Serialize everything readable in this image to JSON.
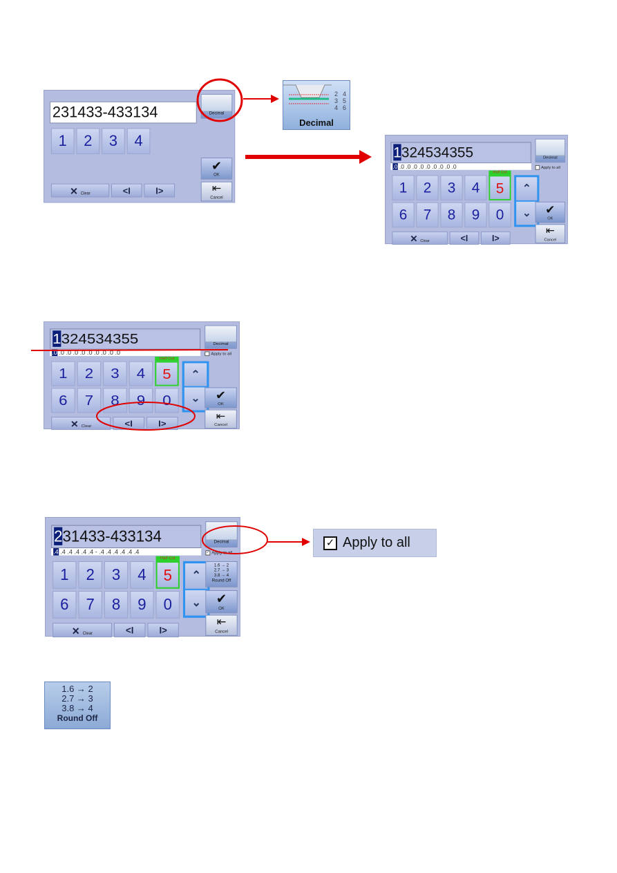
{
  "labels": {
    "clear": "Clear",
    "ok": "OK",
    "cancel": "Cancel",
    "decimal": "Decimal",
    "apply_to_all": "Apply to all",
    "half_cut": "Half Cut",
    "prev": "<I",
    "next": "I>",
    "clear_icon": "✕",
    "ok_icon": "✔",
    "cancel_icon": "⇤",
    "up": "⌃",
    "down": "⌄"
  },
  "panels": [
    {
      "id": "panel-1",
      "main": "231433-433134",
      "highlight": false,
      "sub": null,
      "keys": [
        "1",
        "2",
        "3",
        "4"
      ],
      "half_cut": false,
      "apply_to_all": null,
      "round_off": false
    },
    {
      "id": "panel-2",
      "main": "1324534355",
      "highlight": true,
      "sub": ".0 .0 .0 .0 .0 .0 .0 .0 .0 .0",
      "keys": [
        "1",
        "2",
        "3",
        "4",
        "5",
        "6",
        "7",
        "8",
        "9",
        "0"
      ],
      "half_cut": true,
      "apply_to_all": false,
      "round_off": false
    },
    {
      "id": "panel-3",
      "main": "1324534355",
      "highlight": true,
      "sub": ".0 .0 .0 .0 .0 .0 .0 .0 .0 .0",
      "keys": [
        "1",
        "2",
        "3",
        "4",
        "5",
        "6",
        "7",
        "8",
        "9",
        "0"
      ],
      "half_cut": true,
      "apply_to_all": false,
      "round_off": false
    },
    {
      "id": "panel-4",
      "main": "231433-433134",
      "highlight": true,
      "sub": ".4 .4 .4 .4 .4 .4  -  .4 .4 .4 .4 .4 .4",
      "keys": [
        "1",
        "2",
        "3",
        "4",
        "5",
        "6",
        "7",
        "8",
        "9",
        "0"
      ],
      "half_cut": true,
      "apply_to_all": true,
      "round_off": true
    }
  ],
  "decimal_zoom": {
    "label": "Decimal",
    "digits_left": "2\n3\n4",
    "digits_right": "4\n5\n6"
  },
  "apply_zoom": {
    "label": "Apply to all",
    "checked": true
  },
  "round_off": {
    "lines": [
      "1.6 → 2",
      "2.7 → 3",
      "3.8 → 4"
    ],
    "label": "Round Off"
  },
  "colors": {
    "annotation": "#e00000",
    "panel": "#b4bde0",
    "key_text": "#1a1f9e",
    "half_cut": "#2bd02b",
    "arrow_keys": "#2f93ef"
  }
}
